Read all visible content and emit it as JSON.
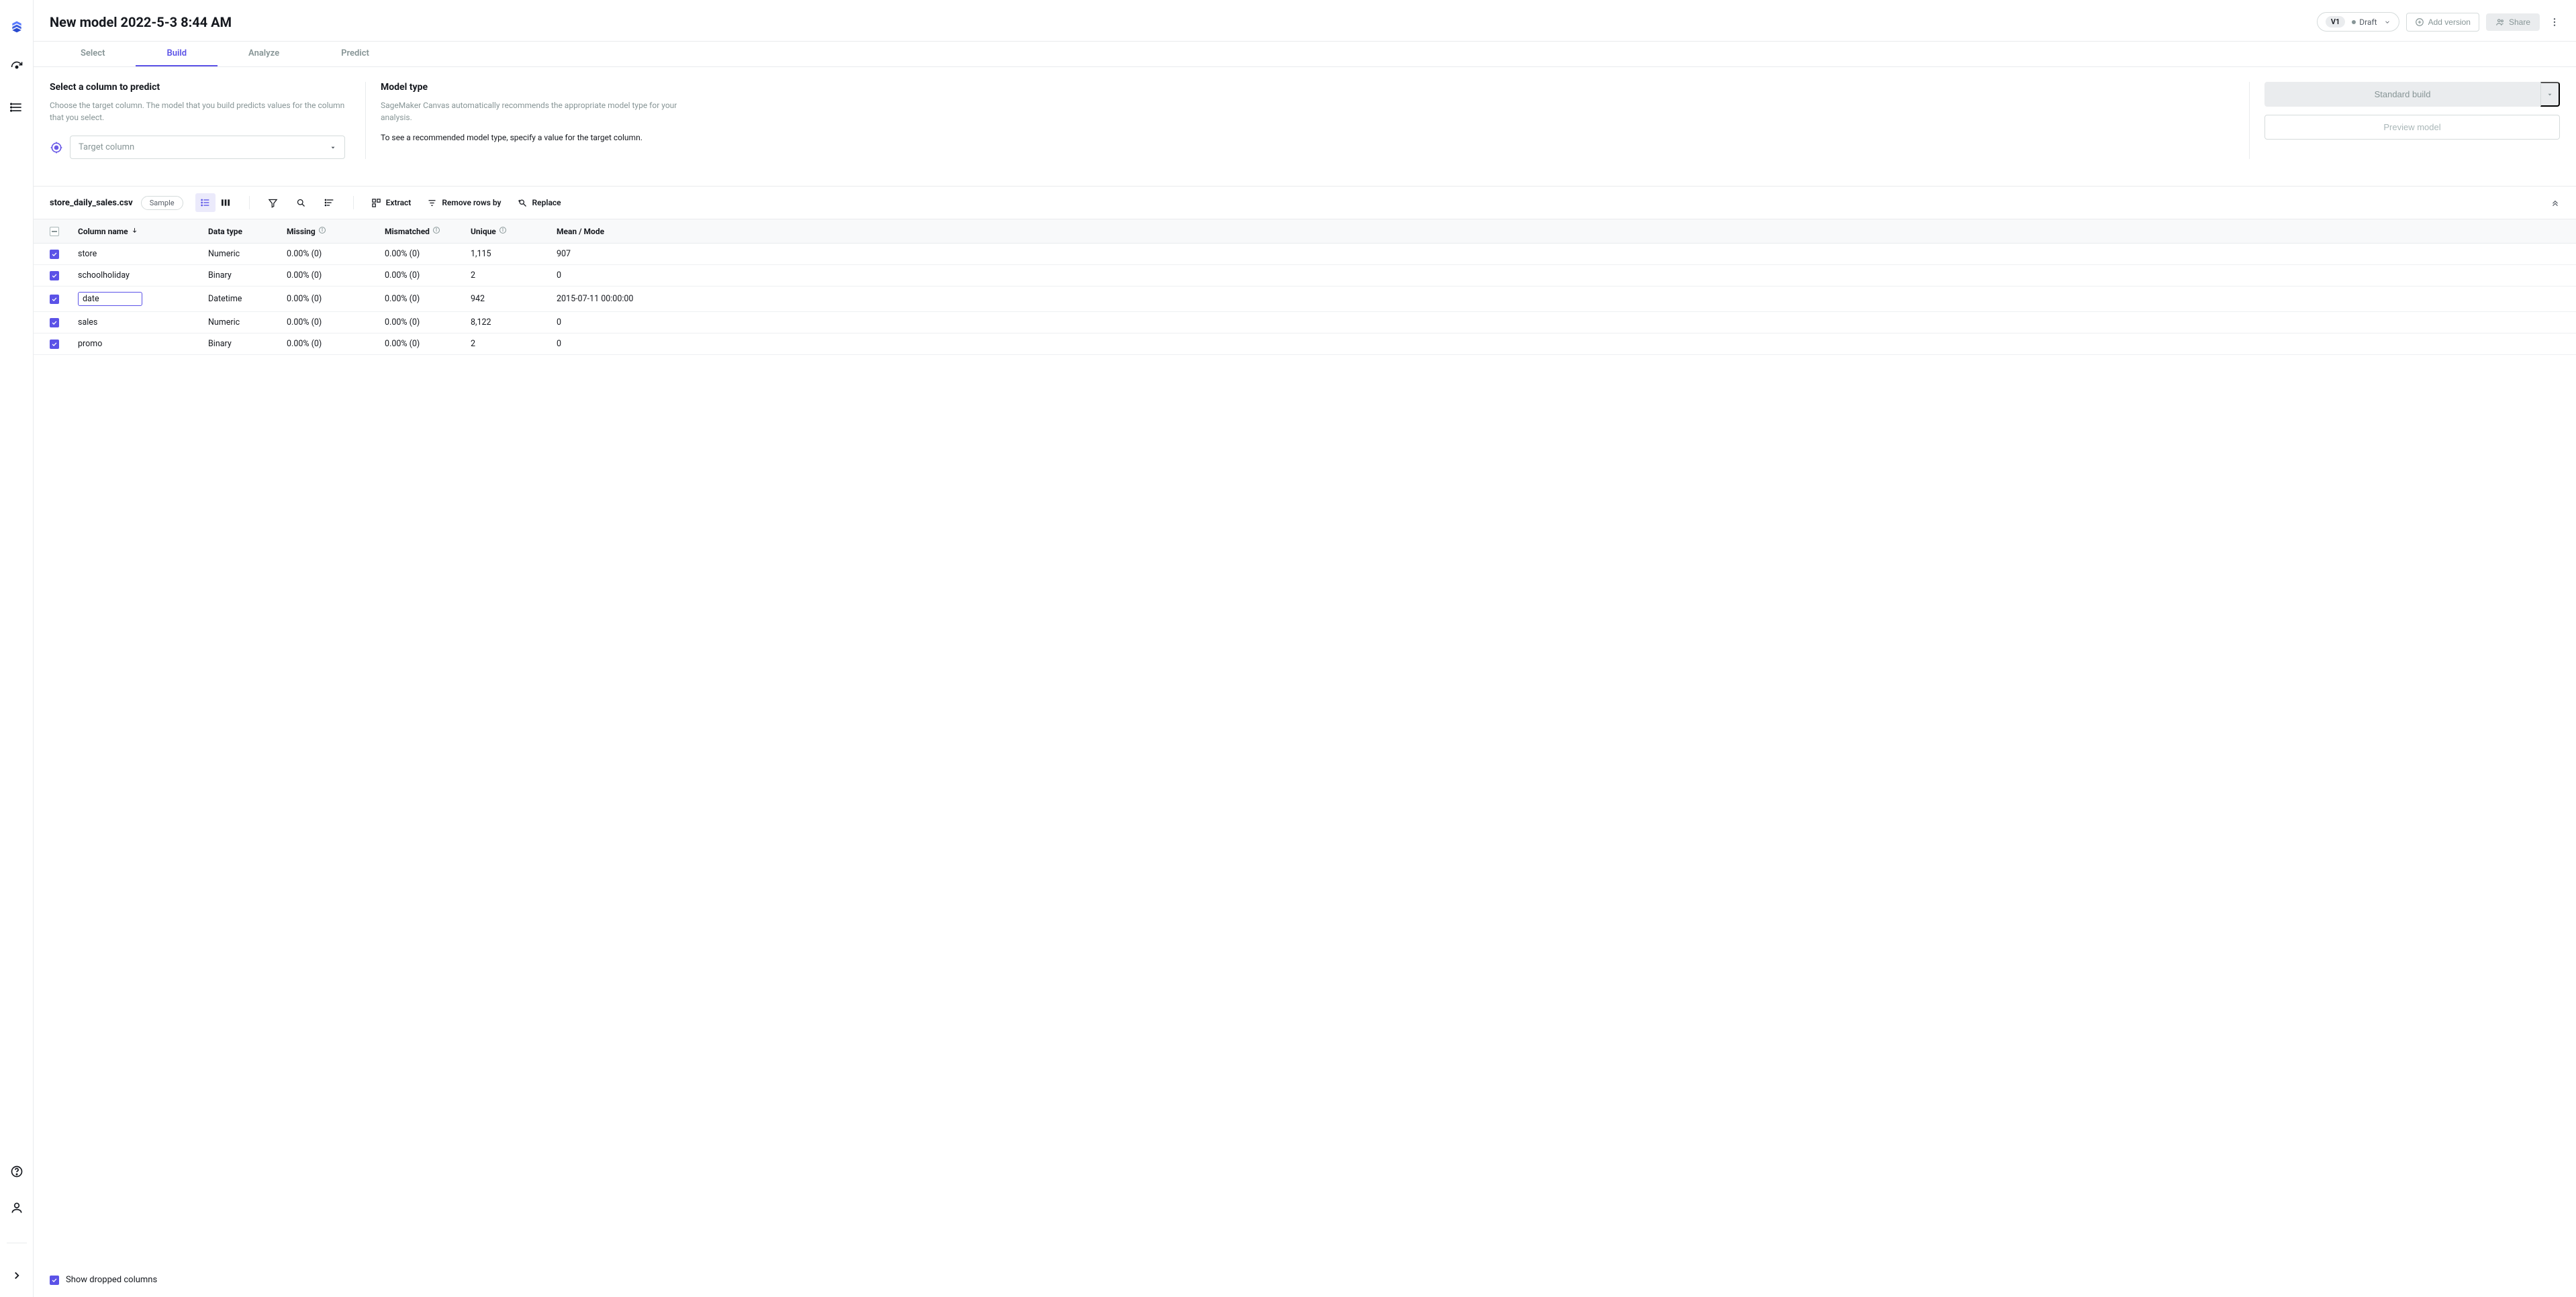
{
  "header": {
    "title": "New model 2022-5-3 8:44 AM",
    "version_badge": "V1",
    "status": "Draft",
    "add_version": "Add version",
    "share": "Share"
  },
  "tabs": [
    "Select",
    "Build",
    "Analyze",
    "Predict"
  ],
  "active_tab": 1,
  "panel": {
    "col1_title": "Select a column to predict",
    "col1_desc": "Choose the target column. The model that you build predicts values for the column that you select.",
    "target_placeholder": "Target column",
    "col2_title": "Model type",
    "col2_desc1": "SageMaker Canvas automatically recommends the appropriate model type for your analysis.",
    "col2_desc2": "To see a recommended model type, specify a value for the target column.",
    "standard_build": "Standard build",
    "preview_model": "Preview model"
  },
  "data_bar": {
    "filename": "store_daily_sales.csv",
    "sample": "Sample",
    "extract": "Extract",
    "remove_rows": "Remove rows by",
    "replace": "Replace"
  },
  "table": {
    "headers": {
      "name": "Column name",
      "type": "Data type",
      "missing": "Missing",
      "mismatched": "Mismatched",
      "unique": "Unique",
      "mean": "Mean / Mode"
    },
    "rows": [
      {
        "name": "store",
        "type": "Numeric",
        "missing": "0.00% (0)",
        "mismatched": "0.00% (0)",
        "unique": "1,115",
        "mean": "907",
        "editing": false
      },
      {
        "name": "schoolholiday",
        "type": "Binary",
        "missing": "0.00% (0)",
        "mismatched": "0.00% (0)",
        "unique": "2",
        "mean": "0",
        "editing": false
      },
      {
        "name": "date",
        "type": "Datetime",
        "missing": "0.00% (0)",
        "mismatched": "0.00% (0)",
        "unique": "942",
        "mean": "2015-07-11 00:00:00",
        "editing": true
      },
      {
        "name": "sales",
        "type": "Numeric",
        "missing": "0.00% (0)",
        "mismatched": "0.00% (0)",
        "unique": "8,122",
        "mean": "0",
        "editing": false
      },
      {
        "name": "promo",
        "type": "Binary",
        "missing": "0.00% (0)",
        "mismatched": "0.00% (0)",
        "unique": "2",
        "mean": "0",
        "editing": false
      }
    ]
  },
  "footer": {
    "show_dropped": "Show dropped columns"
  }
}
